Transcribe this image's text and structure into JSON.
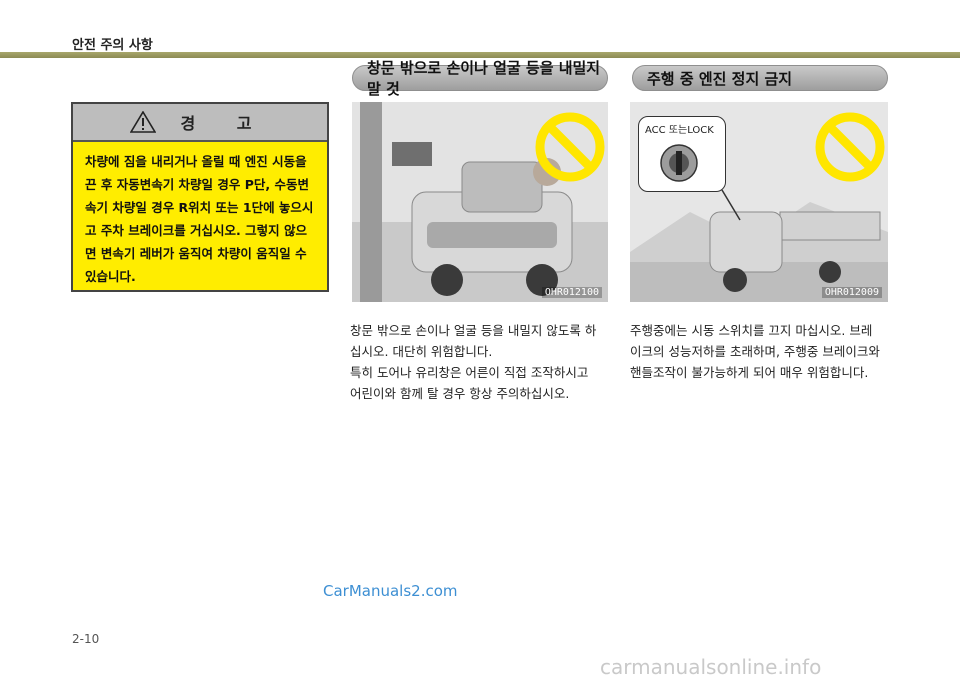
{
  "header": {
    "section_title": "안전 주의 사항"
  },
  "pills": {
    "left": "창문 밖으로 손이나 얼굴 등을 내밀지 말 것",
    "right": "주행 중 엔진 정지 금지"
  },
  "warning": {
    "title": "경 고",
    "lines": [
      "차량에 짐을 내리거나 올릴 때 엔진 시동을",
      "끈 후 자동변속기 차량일 경우 P단, 수동변",
      "속기 차량일 경우 R위치 또는 1단에 놓으시",
      "고 주차 브레이크를 거십시오. 그렇지 않으",
      "면 변속기 레버가 움직여 차량이 움직일 수",
      "있습니다."
    ]
  },
  "photos": {
    "left": {
      "code": "OHR012100"
    },
    "right": {
      "code": "OHR012009",
      "callout": "ACC 또는LOCK"
    }
  },
  "body": {
    "left": [
      "창문 밖으로 손이나 얼굴 등을 내밀지 않도록 하",
      "십시오. 대단히 위험합니다.",
      "특히 도어나 유리창은 어른이 직접 조작하시고",
      "어린이와 함께 탈 경우 항상 주의하십시오."
    ],
    "right": [
      "주행중에는 시동 스위치를 끄지 마십시오. 브레",
      "이크의 성능저하를 초래하며, 주행중 브레이크와",
      "핸들조작이 불가능하게 되어 매우 위험합니다."
    ]
  },
  "watermark": "CarManuals2.com",
  "page_number": "2-10",
  "footer_watermark": "carmanualsonline.info",
  "colors": {
    "warning_bg": "#ffed00",
    "header_band": "#9a9960",
    "prohibit": "#ffe600"
  }
}
